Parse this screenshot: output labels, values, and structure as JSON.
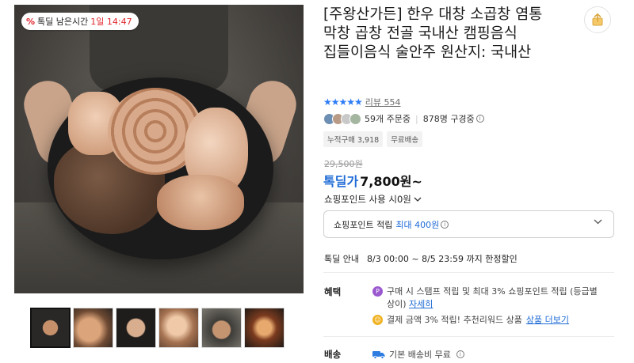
{
  "gallery": {
    "deal_badge": {
      "percent_icon": "%",
      "label": "톡딜 남은시간",
      "remaining": "1일 14:47"
    },
    "thumbnail_count": 6
  },
  "product": {
    "title": "[주왕산가든] 한우 대창 소곱창 염통 막창 곱창 전골 국내산 캠핑음식 집들이음식 술안주 원산지: 국내산",
    "rating_stars": "★★★★★",
    "review_label": "리뷰 554",
    "orders": "59개 주문중",
    "views": "878명 구경중",
    "tags": [
      "누적구매 3,918",
      "무료배송"
    ],
    "original_price": "29,500원",
    "sale_label": "톡딜가",
    "sale_price": "7,800원~",
    "point_use_label": "쇼핑포인트 사용 시0원",
    "point_box_label": "쇼핑포인트 적립",
    "point_box_max": "최대 400원",
    "special_label": "톡딜 안내",
    "special_value": "8/3 00:00 ~ 8/5 23:59 까지 한정할인",
    "benefit_label": "혜택",
    "benefit1_text": "구매 시 스탬프 적립 및 최대 3% 쇼핑포인트 적립 (등급별 상이)",
    "benefit1_link": "자세히",
    "benefit2_text": "결제 금액 3% 적립! 추천리워드 상품",
    "benefit2_link": "상품 더보기",
    "shipping_label": "배송",
    "shipping_value": "기본 배송비 무료"
  },
  "colors": {
    "accent_blue": "#1f6bd6",
    "deal_red": "#e0242c",
    "star_blue": "#2c7cf6"
  },
  "icons": [
    "share-icon",
    "info-icon",
    "chevron-down-icon",
    "truck-icon",
    "point-icon",
    "reward-icon"
  ]
}
